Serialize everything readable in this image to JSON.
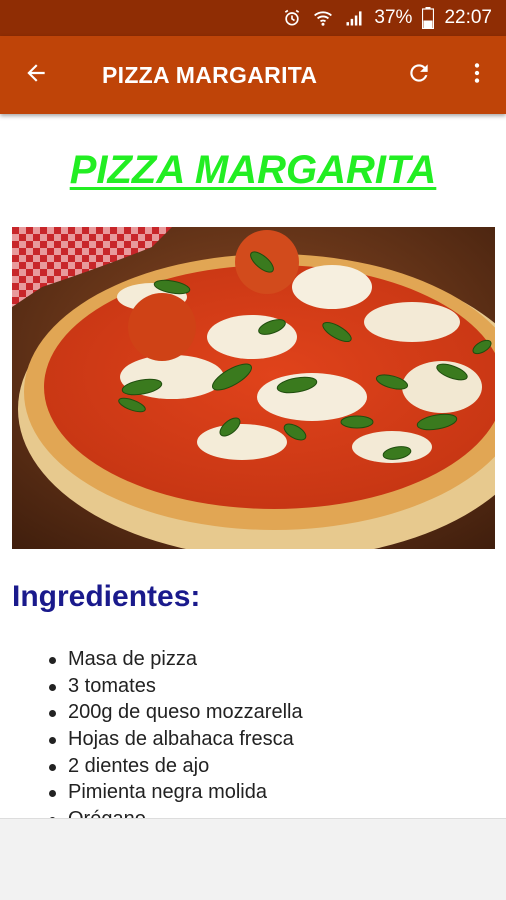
{
  "status_bar": {
    "battery": "37%",
    "time": "22:07",
    "icons": [
      "alarm-icon",
      "wifi-icon",
      "signal-icon",
      "battery-icon"
    ]
  },
  "app_bar": {
    "title": "PIZZA MARGARITA",
    "icons": [
      "back-arrow-icon",
      "refresh-icon",
      "more-vert-icon"
    ]
  },
  "content": {
    "heading": "PIZZA MARGARITA",
    "section_title": "Ingredientes:",
    "ingredients": [
      "Masa de pizza",
      "3 tomates",
      "200g de queso mozzarella",
      "Hojas de albahaca fresca",
      "2 dientes de ajo",
      "Pimienta negra molida",
      "Orégano"
    ]
  },
  "colors": {
    "status_bar": "#8f2d04",
    "app_bar": "#bf4408",
    "heading": "#22ee22",
    "section_title": "#1a1a8c"
  }
}
